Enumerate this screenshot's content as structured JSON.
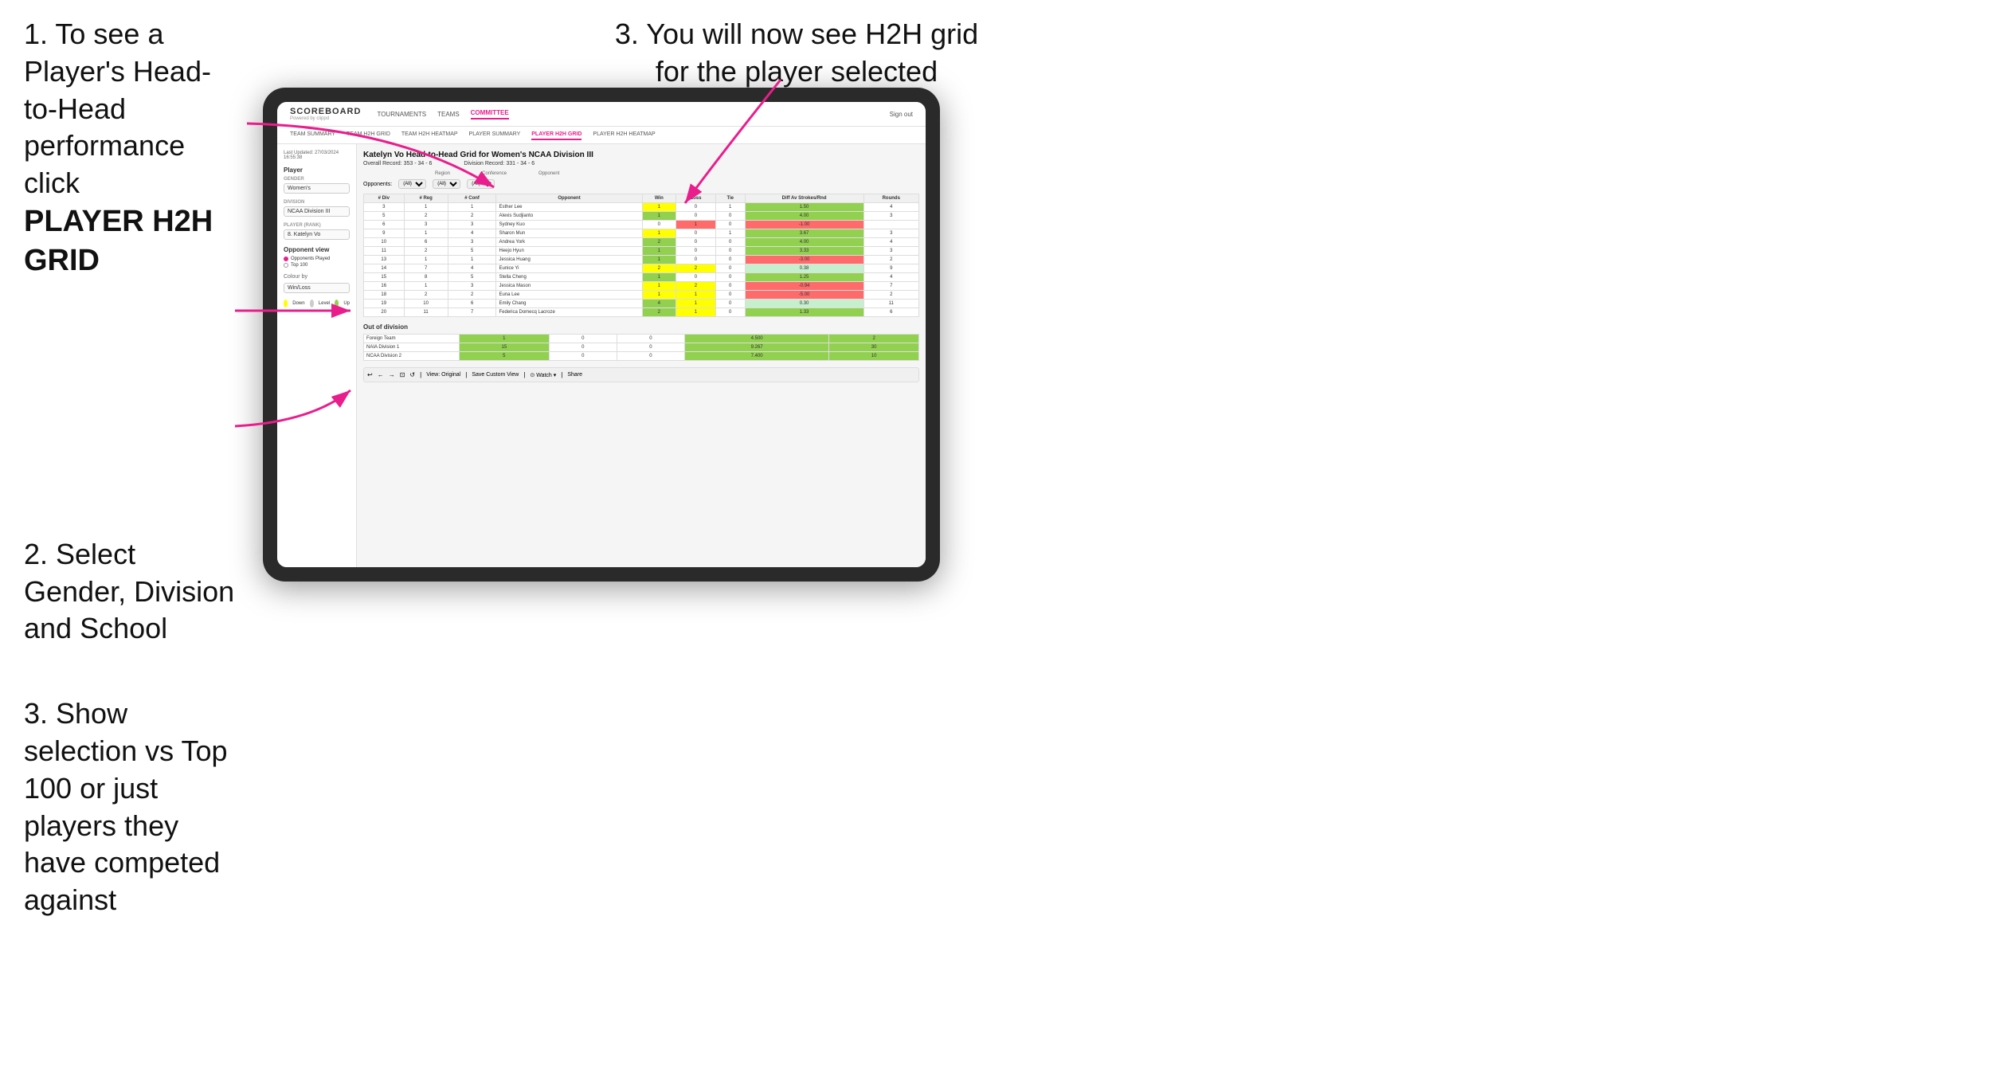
{
  "instructions": {
    "step1_title": "1. To see a Player's Head-to-Head performance click",
    "step1_bold": "PLAYER H2H GRID",
    "step2_title": "2. Select Gender, Division and School",
    "step3_left_title": "3. Show selection vs Top 100 or just players they have competed against",
    "step3_right_title": "3. You will now see H2H grid for the player selected"
  },
  "app": {
    "logo": "SCOREBOARD",
    "logo_sub": "Powered by clippd",
    "sign_out": "Sign out"
  },
  "nav": {
    "items": [
      "TOURNAMENTS",
      "TEAMS",
      "COMMITTEE"
    ],
    "active": "COMMITTEE"
  },
  "sub_nav": {
    "items": [
      "TEAM SUMMARY",
      "TEAM H2H GRID",
      "TEAM H2H HEATMAP",
      "PLAYER SUMMARY",
      "PLAYER H2H GRID",
      "PLAYER H2H HEATMAP"
    ],
    "active": "PLAYER H2H GRID"
  },
  "sidebar": {
    "last_updated": "Last Updated: 27/03/2024",
    "last_time": "16:55:38",
    "player_label": "Player",
    "gender_label": "Gender",
    "gender_value": "Women's",
    "division_label": "Division",
    "division_value": "NCAA Division III",
    "player_rank_label": "Player (Rank)",
    "player_rank_value": "8. Katelyn Vo",
    "opponent_view_label": "Opponent view",
    "opponent_options": [
      "Opponents Played",
      "Top 100"
    ],
    "opponent_selected": "Opponents Played",
    "colour_by_label": "Colour by",
    "colour_value": "Win/Loss",
    "legend_down": "Down",
    "legend_level": "Level",
    "legend_up": "Up"
  },
  "main": {
    "title": "Katelyn Vo Head-to-Head Grid for Women's NCAA Division III",
    "overall_record_label": "Overall Record:",
    "overall_record": "353 - 34 - 6",
    "division_record_label": "Division Record:",
    "division_record": "331 - 34 - 6",
    "filters": {
      "opponents_label": "Opponents:",
      "region_label": "Region",
      "conference_label": "Conference",
      "opponent_label": "Opponent",
      "all": "(All)"
    },
    "table_headers": [
      "# Div",
      "# Reg",
      "# Conf",
      "Opponent",
      "Win",
      "Loss",
      "Tie",
      "Diff Av Strokes/Rnd",
      "Rounds"
    ],
    "rows": [
      {
        "div": "3",
        "reg": "1",
        "conf": "1",
        "opponent": "Esther Lee",
        "win": "1",
        "loss": "0",
        "tie": "1",
        "diff": "1.50",
        "rounds": "4",
        "win_color": "yellow",
        "loss_color": "",
        "diff_color": "green"
      },
      {
        "div": "5",
        "reg": "2",
        "conf": "2",
        "opponent": "Alexis Sudjianto",
        "win": "1",
        "loss": "0",
        "tie": "0",
        "diff": "4.00",
        "rounds": "3",
        "win_color": "green",
        "loss_color": "",
        "diff_color": "green"
      },
      {
        "div": "6",
        "reg": "3",
        "conf": "3",
        "opponent": "Sydney Kuo",
        "win": "0",
        "loss": "1",
        "tie": "0",
        "diff": "-1.00",
        "rounds": "",
        "win_color": "",
        "loss_color": "red",
        "diff_color": "red"
      },
      {
        "div": "9",
        "reg": "1",
        "conf": "4",
        "opponent": "Sharon Mun",
        "win": "1",
        "loss": "0",
        "tie": "1",
        "diff": "3.67",
        "rounds": "3",
        "win_color": "yellow",
        "loss_color": "",
        "diff_color": "green"
      },
      {
        "div": "10",
        "reg": "6",
        "conf": "3",
        "opponent": "Andrea York",
        "win": "2",
        "loss": "0",
        "tie": "0",
        "diff": "4.00",
        "rounds": "4",
        "win_color": "green",
        "loss_color": "",
        "diff_color": "green"
      },
      {
        "div": "11",
        "reg": "2",
        "conf": "5",
        "opponent": "Heejo Hyun",
        "win": "1",
        "loss": "0",
        "tie": "0",
        "diff": "3.33",
        "rounds": "3",
        "win_color": "green",
        "loss_color": "",
        "diff_color": "green"
      },
      {
        "div": "13",
        "reg": "1",
        "conf": "1",
        "opponent": "Jessica Huang",
        "win": "1",
        "loss": "0",
        "tie": "0",
        "diff": "-3.00",
        "rounds": "2",
        "win_color": "green",
        "loss_color": "",
        "diff_color": "red"
      },
      {
        "div": "14",
        "reg": "7",
        "conf": "4",
        "opponent": "Eunice Yi",
        "win": "2",
        "loss": "2",
        "tie": "0",
        "diff": "0.38",
        "rounds": "9",
        "win_color": "yellow",
        "loss_color": "yellow",
        "diff_color": "light-green"
      },
      {
        "div": "15",
        "reg": "8",
        "conf": "5",
        "opponent": "Stella Cheng",
        "win": "1",
        "loss": "0",
        "tie": "0",
        "diff": "1.25",
        "rounds": "4",
        "win_color": "green",
        "loss_color": "",
        "diff_color": "green"
      },
      {
        "div": "16",
        "reg": "1",
        "conf": "3",
        "opponent": "Jessica Mason",
        "win": "1",
        "loss": "2",
        "tie": "0",
        "diff": "-0.94",
        "rounds": "7",
        "win_color": "yellow",
        "loss_color": "yellow",
        "diff_color": "red"
      },
      {
        "div": "18",
        "reg": "2",
        "conf": "2",
        "opponent": "Euna Lee",
        "win": "1",
        "loss": "1",
        "tie": "0",
        "diff": "-5.00",
        "rounds": "2",
        "win_color": "yellow",
        "loss_color": "yellow",
        "diff_color": "red"
      },
      {
        "div": "19",
        "reg": "10",
        "conf": "6",
        "opponent": "Emily Chang",
        "win": "4",
        "loss": "1",
        "tie": "0",
        "diff": "0.30",
        "rounds": "11",
        "win_color": "green",
        "loss_color": "yellow",
        "diff_color": "light-green"
      },
      {
        "div": "20",
        "reg": "11",
        "conf": "7",
        "opponent": "Federica Domecq Lacroze",
        "win": "2",
        "loss": "1",
        "tie": "0",
        "diff": "1.33",
        "rounds": "6",
        "win_color": "green",
        "loss_color": "yellow",
        "diff_color": "green"
      }
    ],
    "out_of_division_label": "Out of division",
    "ood_rows": [
      {
        "team": "Foreign Team",
        "win": "1",
        "loss": "0",
        "tie": "0",
        "diff": "4.500",
        "rounds": "2",
        "win_color": "green"
      },
      {
        "team": "NAIA Division 1",
        "win": "15",
        "loss": "0",
        "tie": "0",
        "diff": "9.267",
        "rounds": "30",
        "win_color": "green"
      },
      {
        "team": "NCAA Division 2",
        "win": "5",
        "loss": "0",
        "tie": "0",
        "diff": "7.400",
        "rounds": "10",
        "win_color": "green"
      }
    ],
    "toolbar_items": [
      "↩",
      "←",
      "→",
      "⊡",
      "⟳",
      "·",
      "⏱",
      "View: Original",
      "Save Custom View",
      "⊙ Watch ▾",
      "↕",
      "≡",
      "Share"
    ]
  }
}
